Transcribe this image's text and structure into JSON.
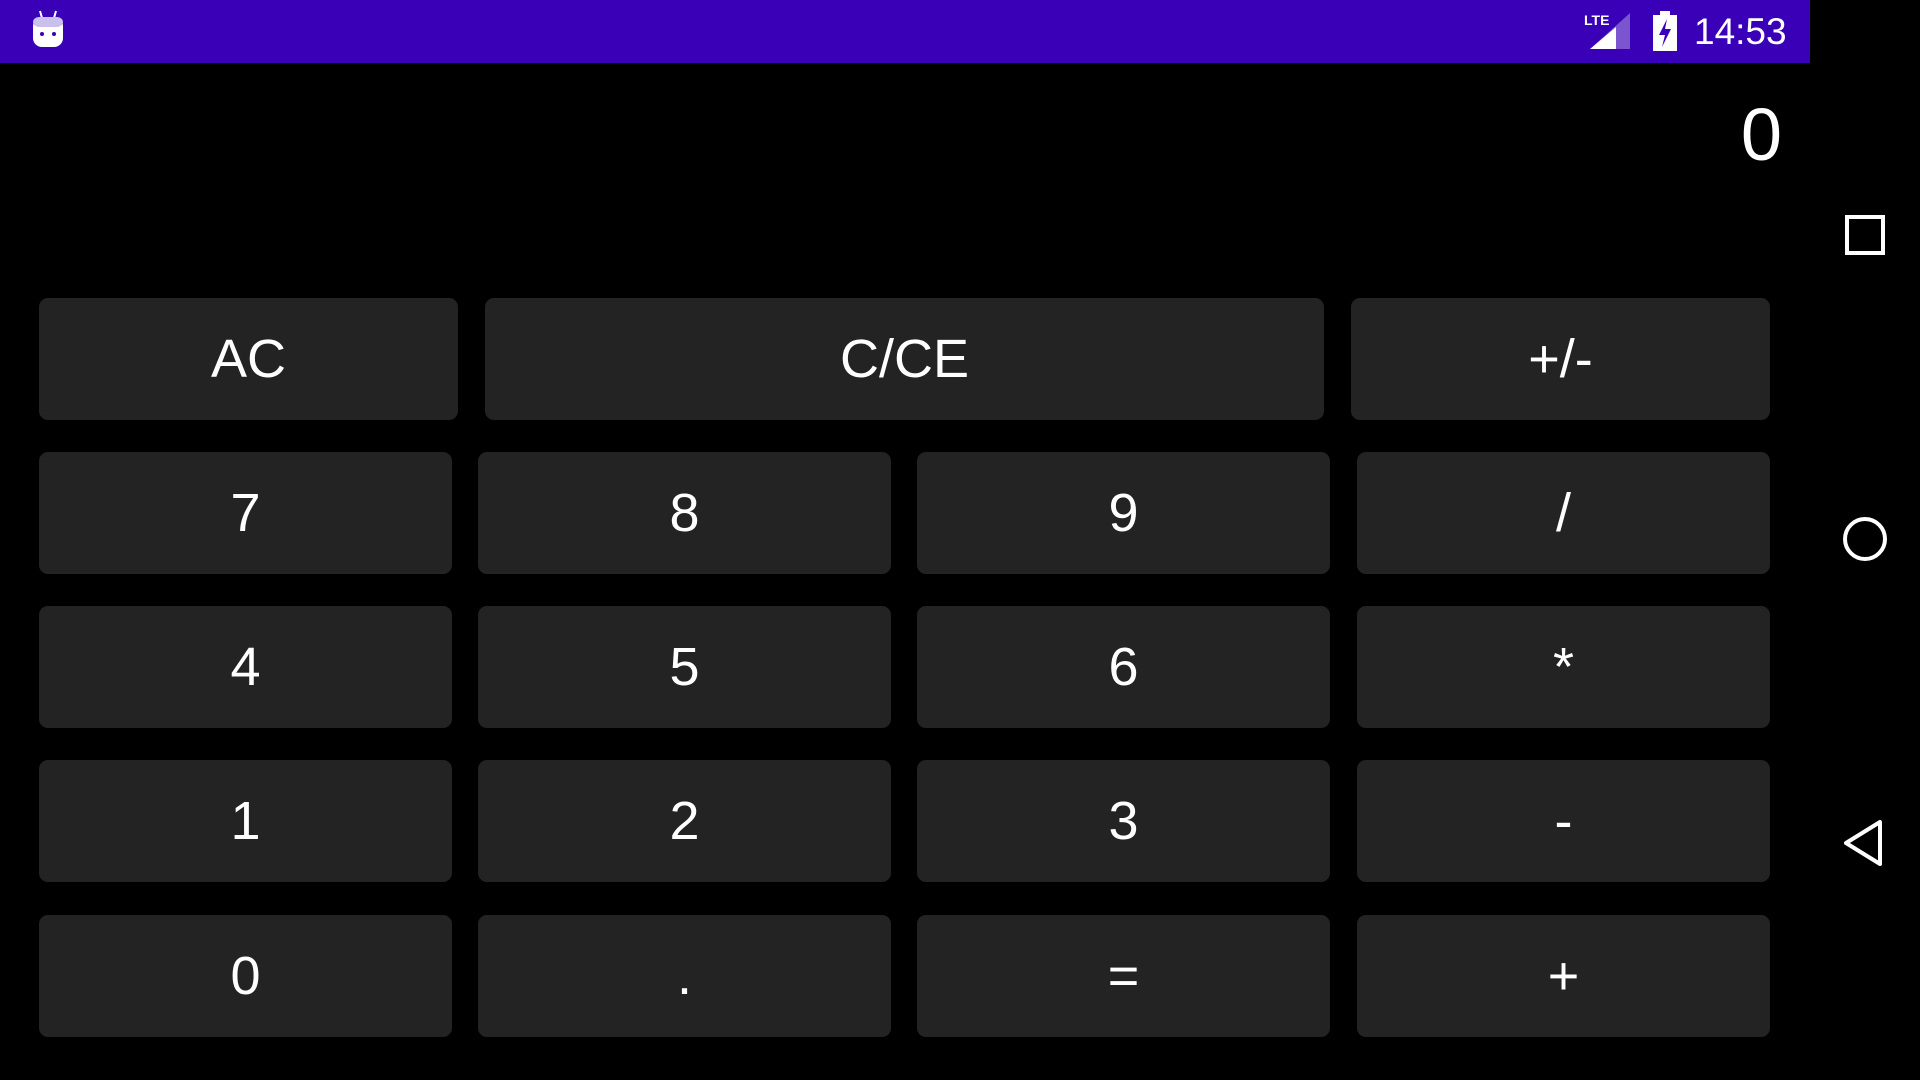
{
  "status_bar": {
    "time": "14:53",
    "network": "LTE",
    "icons": [
      "android-debug-icon",
      "lte-signal-icon",
      "battery-charging-icon"
    ],
    "color": "#3a00b8"
  },
  "display": {
    "value": "0"
  },
  "keypad": {
    "row1": [
      {
        "label": "AC",
        "name": "all-clear"
      },
      {
        "label": "C/CE",
        "name": "clear-entry"
      },
      {
        "label": "+/-",
        "name": "toggle-sign"
      }
    ],
    "rows": [
      [
        {
          "label": "7",
          "name": "digit-7"
        },
        {
          "label": "8",
          "name": "digit-8"
        },
        {
          "label": "9",
          "name": "digit-9"
        },
        {
          "label": "/",
          "name": "divide"
        }
      ],
      [
        {
          "label": "4",
          "name": "digit-4"
        },
        {
          "label": "5",
          "name": "digit-5"
        },
        {
          "label": "6",
          "name": "digit-6"
        },
        {
          "label": "*",
          "name": "multiply"
        }
      ],
      [
        {
          "label": "1",
          "name": "digit-1"
        },
        {
          "label": "2",
          "name": "digit-2"
        },
        {
          "label": "3",
          "name": "digit-3"
        },
        {
          "label": "-",
          "name": "subtract"
        }
      ],
      [
        {
          "label": "0",
          "name": "digit-0"
        },
        {
          "label": ".",
          "name": "decimal"
        },
        {
          "label": "=",
          "name": "equals"
        },
        {
          "label": "+",
          "name": "add"
        }
      ]
    ],
    "key_color": "#232323"
  },
  "nav_bar": {
    "icons": [
      "recents-icon",
      "home-icon",
      "back-icon"
    ]
  }
}
